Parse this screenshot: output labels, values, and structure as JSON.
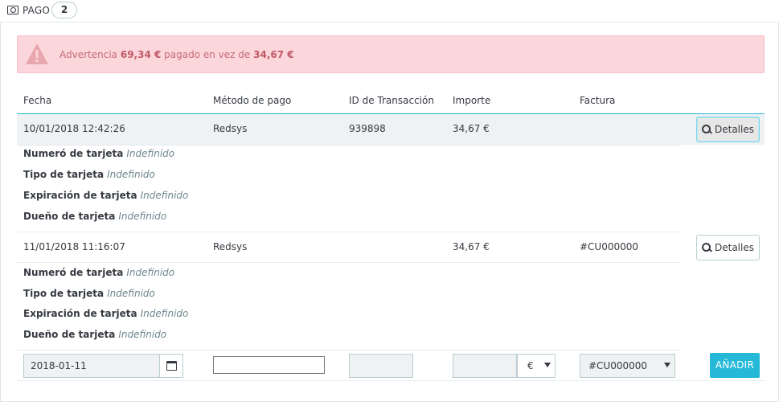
{
  "header": {
    "title": "PAGO",
    "count": "2",
    "icon": "money-icon"
  },
  "alert": {
    "prefix": "Advertencia",
    "paid": "69,34 €",
    "middle": "pagado en vez de",
    "expected": "34,67 €",
    "icon": "warning-icon",
    "color": "#fbd6da"
  },
  "table": {
    "columns": [
      "Fecha",
      "Método de pago",
      "ID de Transacción",
      "Importe",
      "Factura"
    ],
    "rows": [
      {
        "date": "10/01/2018 12:42:26",
        "method": "Redsys",
        "transaction_id": "939898",
        "amount": "34,67 €",
        "invoice": "",
        "details_label": "Detalles",
        "details": [
          {
            "label": "Numeró de tarjeta",
            "value": "Indefinido"
          },
          {
            "label": "Tipo de tarjeta",
            "value": "Indefinido"
          },
          {
            "label": "Expiración de tarjeta",
            "value": "Indefinido"
          },
          {
            "label": "Dueño de tarjeta",
            "value": "Indefinido"
          }
        ]
      },
      {
        "date": "11/01/2018 11:16:07",
        "method": "Redsys",
        "transaction_id": "",
        "amount": "34,67 €",
        "invoice": "#CU000000",
        "details_label": "Detalles",
        "details": [
          {
            "label": "Numeró de tarjeta",
            "value": "Indefinido"
          },
          {
            "label": "Tipo de tarjeta",
            "value": "Indefinido"
          },
          {
            "label": "Expiración de tarjeta",
            "value": "Indefinido"
          },
          {
            "label": "Dueño de tarjeta",
            "value": "Indefinido"
          }
        ]
      }
    ]
  },
  "form": {
    "date_value": "2018-01-11",
    "method_value": "",
    "transaction_value": "",
    "amount_value": "",
    "currency": "€",
    "invoice": "#CU000000",
    "add_label": "AÑADIR",
    "accent_color": "#25b9d7"
  }
}
